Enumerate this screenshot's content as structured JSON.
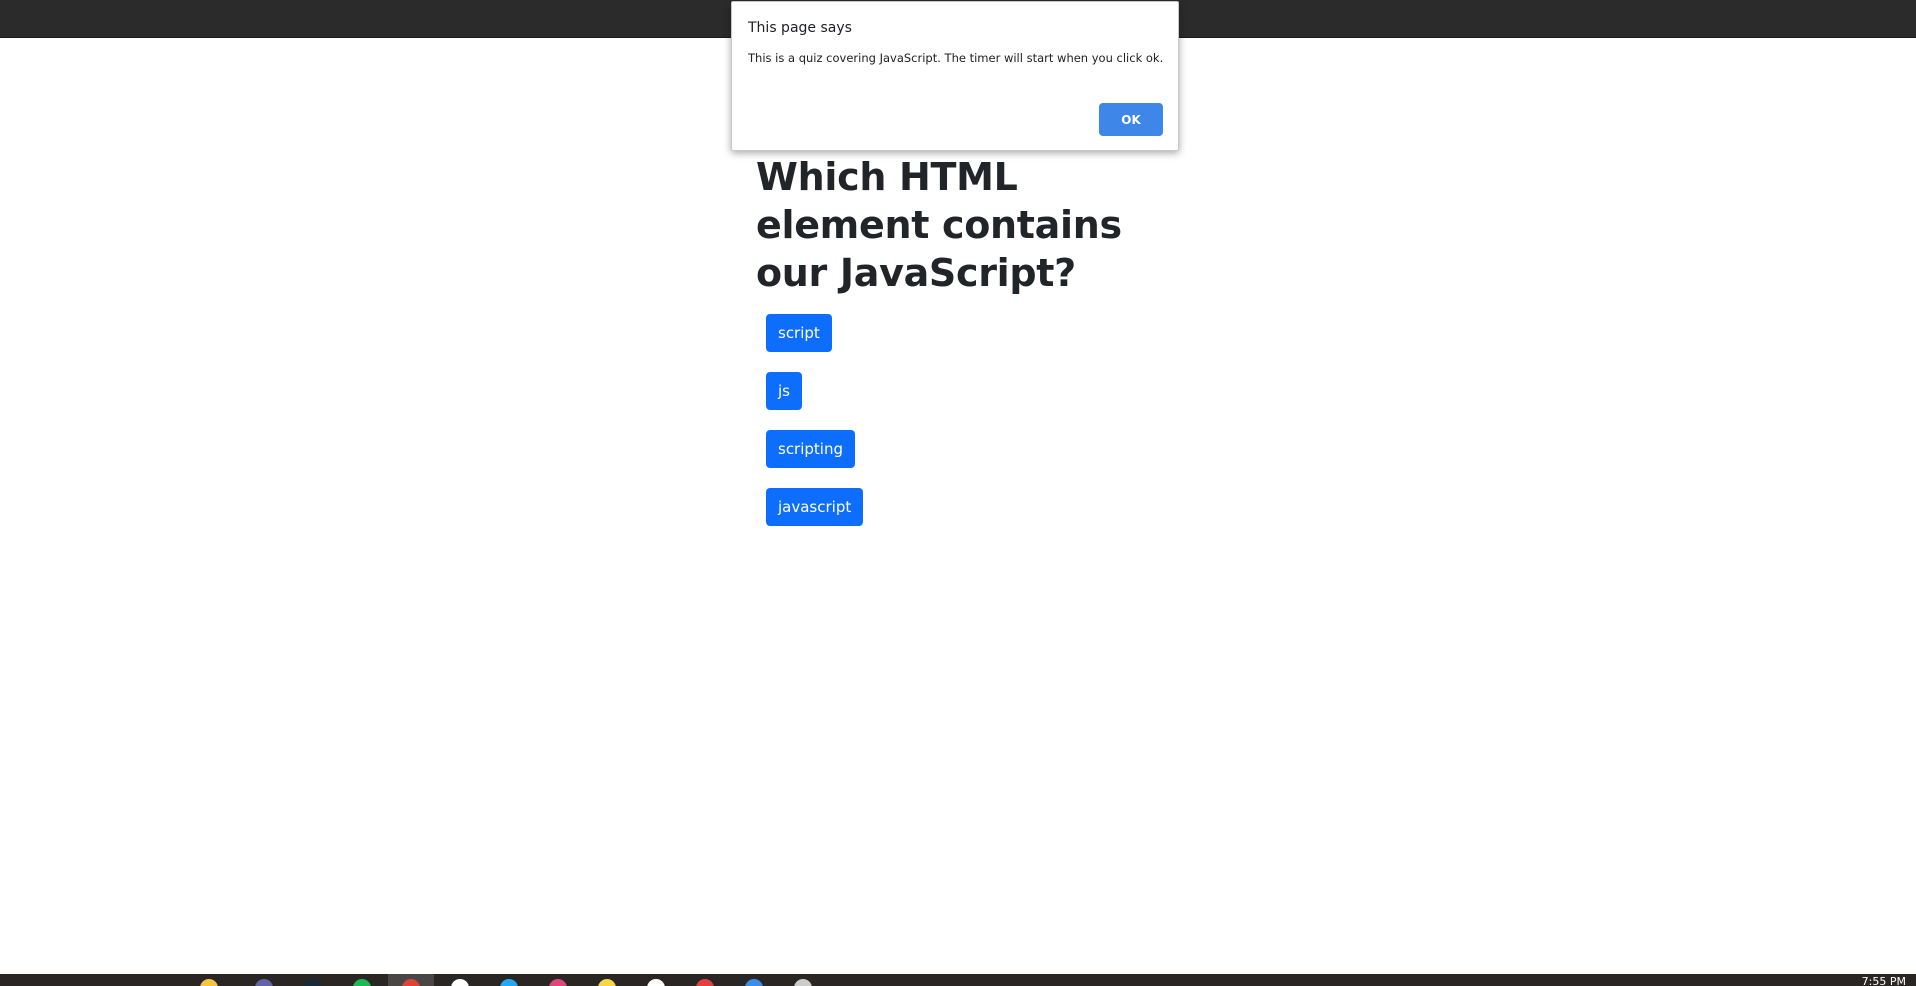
{
  "page": {
    "question": "Which HTML element contains our JavaScript?",
    "answers": [
      "script",
      "js",
      "scripting",
      "javascript"
    ]
  },
  "alert": {
    "title": "This page says",
    "message": "This is a quiz covering JavaScript. The timer will start when you click ok.",
    "ok_label": "OK"
  },
  "taskbar": {
    "clock": "7:55 PM",
    "icons": [
      "file-explorer-icon",
      "teams-icon",
      "steam-icon",
      "spotify-icon",
      "chrome-icon",
      "github-icon",
      "vscode-icon",
      "app-icon",
      "sticky-notes-icon",
      "app-icon",
      "app-icon",
      "app-icon",
      "app-icon"
    ]
  },
  "colors": {
    "primary_button": "#0d6efd",
    "alert_ok_button": "#3e87e8",
    "topbar": "#2b2b2b",
    "taskbar": "#2a2623"
  }
}
